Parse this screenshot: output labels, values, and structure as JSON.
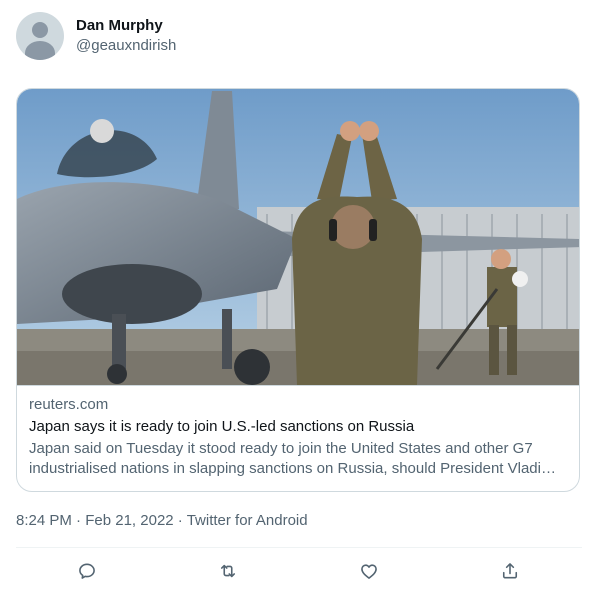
{
  "author": {
    "display_name": "Dan Murphy",
    "handle": "@geauxndirish",
    "avatar_icon": "default-avatar-icon"
  },
  "card": {
    "image_alt": "Ground crew member signaling to an F-16 fighter jet on a tarmac",
    "domain": "reuters.com",
    "title": "Japan says it is ready to join U.S.-led sanctions on Russia",
    "description": "Japan said on Tuesday it stood ready to join the United States and other G7 industrialised nations in slapping sanctions on Russia, should President Vladimir Putin move forward with an invasion of Ukraine."
  },
  "meta": {
    "time": "8:24 PM",
    "separator": "·",
    "date": "Feb 21, 2022",
    "source": "Twitter for Android"
  },
  "actions": [
    {
      "icon": "reply-icon"
    },
    {
      "icon": "retweet-icon"
    },
    {
      "icon": "like-icon"
    },
    {
      "icon": "share-icon"
    }
  ],
  "colors": {
    "text_primary": "#0f1419",
    "text_secondary": "#536471",
    "border": "#cfd9de"
  }
}
